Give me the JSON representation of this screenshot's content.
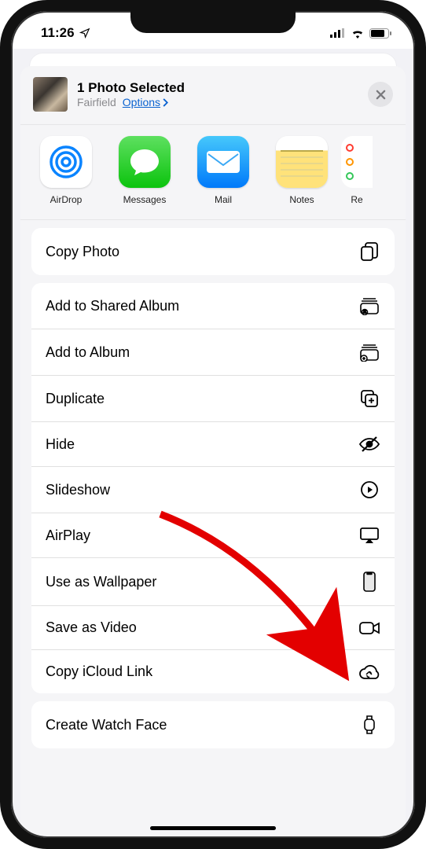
{
  "status": {
    "time": "11:26",
    "location_arrow": "➤"
  },
  "header": {
    "title": "1 Photo Selected",
    "subtitle_location": "Fairfield",
    "options_label": "Options"
  },
  "apps": [
    {
      "label": "AirDrop"
    },
    {
      "label": "Messages"
    },
    {
      "label": "Mail"
    },
    {
      "label": "Notes"
    },
    {
      "label": "Re"
    }
  ],
  "actions_top": [
    {
      "label": "Copy Photo",
      "icon": "copy-icon"
    }
  ],
  "actions_main": [
    {
      "label": "Add to Shared Album",
      "icon": "shared-album-icon"
    },
    {
      "label": "Add to Album",
      "icon": "add-album-icon"
    },
    {
      "label": "Duplicate",
      "icon": "duplicate-icon"
    },
    {
      "label": "Hide",
      "icon": "hide-icon"
    },
    {
      "label": "Slideshow",
      "icon": "play-icon"
    },
    {
      "label": "AirPlay",
      "icon": "airplay-icon"
    },
    {
      "label": "Use as Wallpaper",
      "icon": "phone-icon"
    },
    {
      "label": "Save as Video",
      "icon": "video-icon"
    },
    {
      "label": "Copy iCloud Link",
      "icon": "cloud-link-icon"
    }
  ],
  "actions_bottom": [
    {
      "label": "Create Watch Face",
      "icon": "watch-icon"
    }
  ]
}
